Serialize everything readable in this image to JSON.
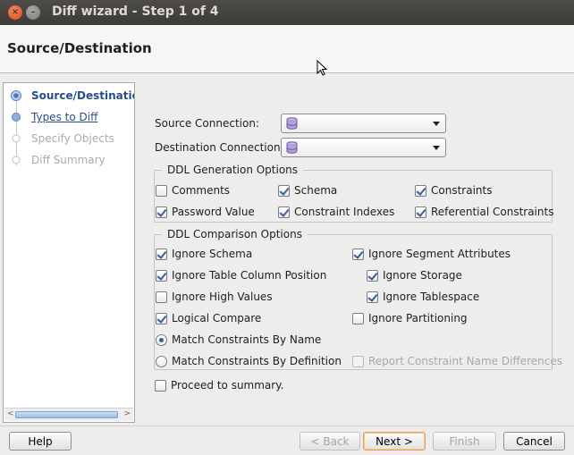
{
  "window": {
    "title": "Diff wizard - Step 1 of 4",
    "close_glyph": "×",
    "min_glyph": "–"
  },
  "header": {
    "title": "Source/Destination"
  },
  "steps": [
    {
      "label": "Source/Destination",
      "state": "current"
    },
    {
      "label": "Types to Diff",
      "state": "link"
    },
    {
      "label": "Specify Objects",
      "state": "disabled"
    },
    {
      "label": "Diff Summary",
      "state": "disabled"
    }
  ],
  "scrollbar": {
    "left": "<",
    "right": ">"
  },
  "connections": {
    "source_label": "Source Connection:",
    "source_value": "",
    "destination_label": "Destination Connection:",
    "destination_value": ""
  },
  "ddl_generation": {
    "title": "DDL Generation Options",
    "options": [
      {
        "label": "Comments",
        "checked": false
      },
      {
        "label": "Schema",
        "checked": true
      },
      {
        "label": "Constraints",
        "checked": true
      },
      {
        "label": "Password Value",
        "checked": true
      },
      {
        "label": "Constraint Indexes",
        "checked": true
      },
      {
        "label": "Referential Constraints",
        "checked": true
      }
    ]
  },
  "ddl_comparison": {
    "title": "DDL Comparison Options",
    "options": [
      {
        "label": "Ignore Schema",
        "checked": true
      },
      {
        "label": "Ignore Segment Attributes",
        "checked": true
      },
      {
        "label": "Ignore Table Column Position",
        "checked": true
      },
      {
        "label": "Ignore Storage",
        "checked": true
      },
      {
        "label": "Ignore High Values",
        "checked": false
      },
      {
        "label": "Ignore Tablespace",
        "checked": true
      },
      {
        "label": "Logical Compare",
        "checked": true
      },
      {
        "label": "Ignore Partitioning",
        "checked": false
      },
      {
        "label": "Match Constraints By Name",
        "checked": true
      },
      {
        "label": "Match Constraints By Definition",
        "checked": false
      },
      {
        "label": "Report Constraint Name Differences",
        "checked": false,
        "disabled": true
      }
    ]
  },
  "proceed": {
    "label": "Proceed to summary.",
    "checked": false
  },
  "buttons": {
    "help": "Help",
    "back": "< Back",
    "next": "Next >",
    "finish": "Finish",
    "cancel": "Cancel"
  },
  "colors": {
    "accent": "#254f86",
    "check": "#3a5f99",
    "titlebar": "#3c3b37"
  }
}
